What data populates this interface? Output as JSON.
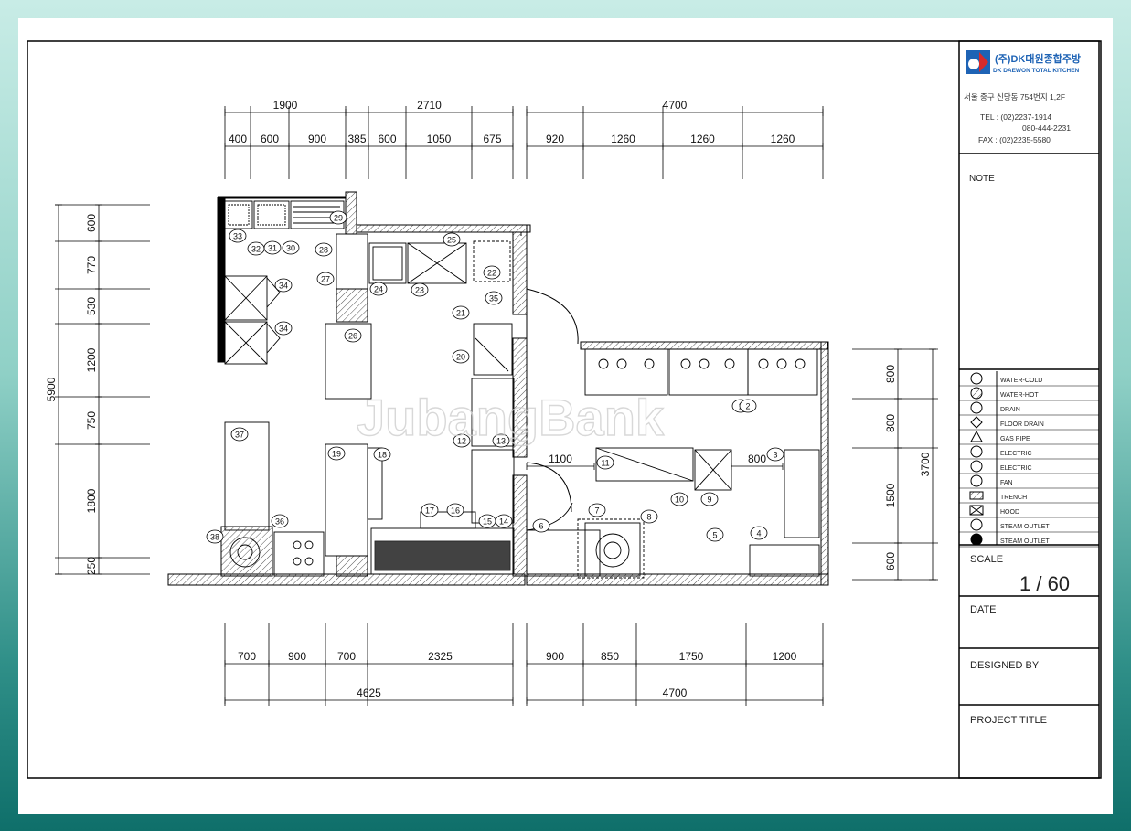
{
  "logo": {
    "brand": "(주)DK대원종합주방",
    "sub": "DK DAEWON TOTAL KITCHEN",
    "mark": "dk"
  },
  "contact": {
    "address": "서울 중구 신당동 754번지 1,2F",
    "tel1": "TEL : (02)2237-1914",
    "tel2": "080-444-2231",
    "fax": "FAX : (02)2235-5580"
  },
  "note_label": "NOTE",
  "legend": [
    {
      "symbol": "circle",
      "label": "WATER-COLD"
    },
    {
      "symbol": "circle-hatched",
      "label": "WATER-HOT"
    },
    {
      "symbol": "circle-dot",
      "label": "DRAIN"
    },
    {
      "symbol": "diamond",
      "label": "FLOOR DRAIN"
    },
    {
      "symbol": "triangle",
      "label": "GAS PIPE"
    },
    {
      "symbol": "circle-bar",
      "label": "ELECTRIC"
    },
    {
      "symbol": "circle-bar2",
      "label": "ELECTRIC"
    },
    {
      "symbol": "circle-fan",
      "label": "FAN"
    },
    {
      "symbol": "trench",
      "label": "TRENCH"
    },
    {
      "symbol": "hood",
      "label": "HOOD"
    },
    {
      "symbol": "half-circle",
      "label": "STEAM OUTLET"
    },
    {
      "symbol": "filled-circle",
      "label": "STEAM OUTLET"
    }
  ],
  "scale_label": "SCALE",
  "scale_value": "1 / 60",
  "date_label": "DATE",
  "designed_label": "DESIGNED BY",
  "project_label": "PROJECT TITLE",
  "watermark": "JubangBank",
  "dims": {
    "top_total": [
      "1900",
      "2710",
      "4700"
    ],
    "top_sub": [
      "400",
      "600",
      "900",
      "385",
      "600",
      "1050",
      "675",
      "920",
      "1260",
      "1260",
      "1260"
    ],
    "left_total": "5900",
    "left_sub": [
      "600",
      "770",
      "530",
      "1200",
      "750",
      "1800",
      "250"
    ],
    "right_total": "3700",
    "right_sub": [
      "800",
      "800",
      "1500",
      "600"
    ],
    "bottom_sub": [
      "700",
      "900",
      "700",
      "2325",
      "900",
      "850",
      "1750",
      "1200"
    ],
    "bottom_total": [
      "4625",
      "4700"
    ],
    "inner": [
      "1100",
      "800",
      "800"
    ]
  },
  "equipment": [
    "1",
    "2",
    "3",
    "4",
    "5",
    "6",
    "7",
    "8",
    "9",
    "10",
    "11",
    "12",
    "13",
    "14",
    "15",
    "16",
    "17",
    "18",
    "19",
    "20",
    "21",
    "22",
    "23",
    "24",
    "25",
    "26",
    "27",
    "28",
    "29",
    "30",
    "31",
    "32",
    "33",
    "34",
    "34",
    "35",
    "36",
    "37",
    "38"
  ]
}
